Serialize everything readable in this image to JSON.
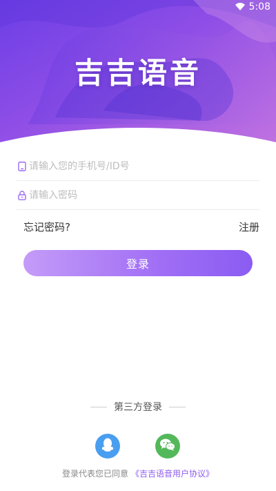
{
  "status_bar": {
    "time": "5:08",
    "wifi_icon": "wifi-icon"
  },
  "header": {
    "app_title": "吉吉语音",
    "gradient_colors": [
      "#7b3fe8",
      "#a65ce4",
      "#d57ee0"
    ]
  },
  "form": {
    "phone": {
      "icon": "phone-icon",
      "placeholder": "请输入您的手机号/ID号",
      "value": ""
    },
    "password": {
      "icon": "lock-icon",
      "placeholder": "请输入密码",
      "value": ""
    },
    "forgot_label": "忘记密码?",
    "register_label": "注册",
    "login_button": "登录",
    "accent_color": "#9b6af4"
  },
  "third_party": {
    "label": "第三方登录",
    "providers": [
      {
        "name": "qq",
        "icon": "qq-penguin-icon",
        "color": "#4a9ef0"
      },
      {
        "name": "wechat",
        "icon": "wechat-icon",
        "color": "#53b85a"
      }
    ]
  },
  "agreement": {
    "prefix": "登录代表您已同意",
    "link": "《吉吉语音用户协议》"
  }
}
